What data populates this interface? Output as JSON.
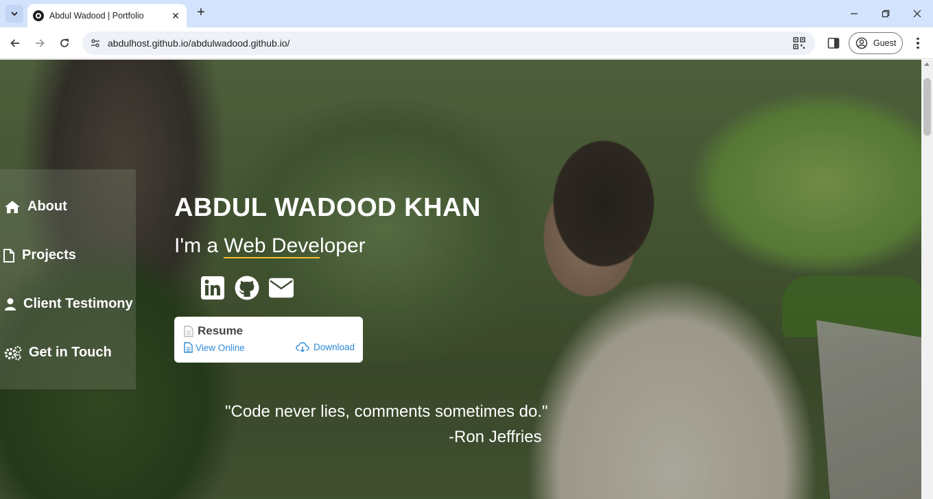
{
  "browser": {
    "tab": {
      "title": "Abdul Wadood | Portfolio"
    },
    "url": "abdulhost.github.io/abdulwadood.github.io/",
    "profile_label": "Guest"
  },
  "page": {
    "nav": [
      {
        "label": "About",
        "icon": "home-icon"
      },
      {
        "label": "Projects",
        "icon": "file-icon"
      },
      {
        "label": "Client Testimony",
        "icon": "user-icon"
      },
      {
        "label": "Get in Touch",
        "icon": "gears-icon"
      }
    ],
    "hero": {
      "name": "ABDUL WADOOD KHAN",
      "role_prefix": "I'm a ",
      "role_typed": "Web Deve",
      "role_rest": "loper"
    },
    "socials": [
      "linkedin-icon",
      "github-icon",
      "envelope-icon"
    ],
    "resume": {
      "title": "Resume",
      "view_label": "View Online",
      "download_label": "Download"
    },
    "quote": {
      "text": "\"Code never lies, comments sometimes do.\"",
      "author": "-Ron Jeffries"
    }
  },
  "colors": {
    "tabbar_bg": "#d3e3fd",
    "underline_accent": "#f2c230",
    "link_blue": "#2b8ad8"
  }
}
